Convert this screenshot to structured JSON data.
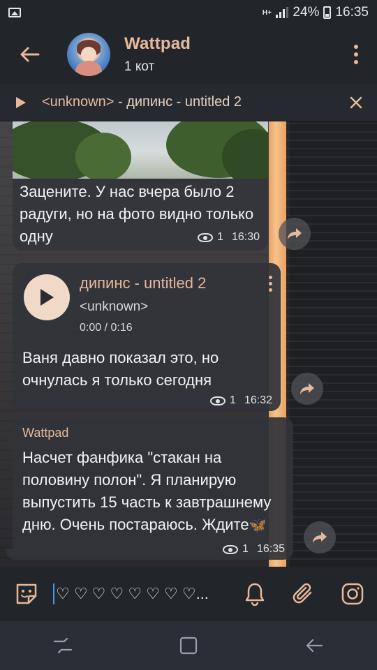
{
  "status_bar": {
    "network": "H+",
    "battery": "24%",
    "time": "16:35"
  },
  "header": {
    "title": "Wattpad",
    "subtitle": "1 кот"
  },
  "player": {
    "performer": "<unknown>",
    "separator": " - ",
    "track": "дипинс - untitled 2"
  },
  "messages": [
    {
      "type": "photo",
      "text": "Зацените. У нас вчера было 2 радуги, но на фото видно только одну",
      "views": "1",
      "time": "16:30"
    },
    {
      "type": "audio",
      "audio_title": "дипинс - untitled 2",
      "audio_performer": "<unknown>",
      "audio_time": "0:00 / 0:16",
      "text": "Ваня давно показал это, но очнулась я только сегодня",
      "views": "1",
      "time": "16:32"
    },
    {
      "type": "text",
      "sender": "Wattpad",
      "text": "Насчет фанфика \"стакан на половину полон\". Я планирую выпустить 15 часть к завтрашнему дню. Очень постараюсь. Ждите",
      "emoji": "🦋",
      "views": "1",
      "time": "16:35"
    }
  ],
  "input": {
    "value": "♡ ♡ ♡ ♡ ♡ ♡ ♡ ♡..."
  },
  "colors": {
    "accent": "#e8b89b",
    "header_bg": "#22262b",
    "bubble_bg": "#32343a"
  },
  "icons": [
    "back-arrow-icon",
    "more-vert-icon",
    "play-icon",
    "close-icon",
    "eye-icon",
    "share-icon",
    "sticker-icon",
    "bell-icon",
    "paperclip-icon",
    "instagram-icon",
    "recents-icon",
    "home-icon",
    "nav-back-icon"
  ]
}
